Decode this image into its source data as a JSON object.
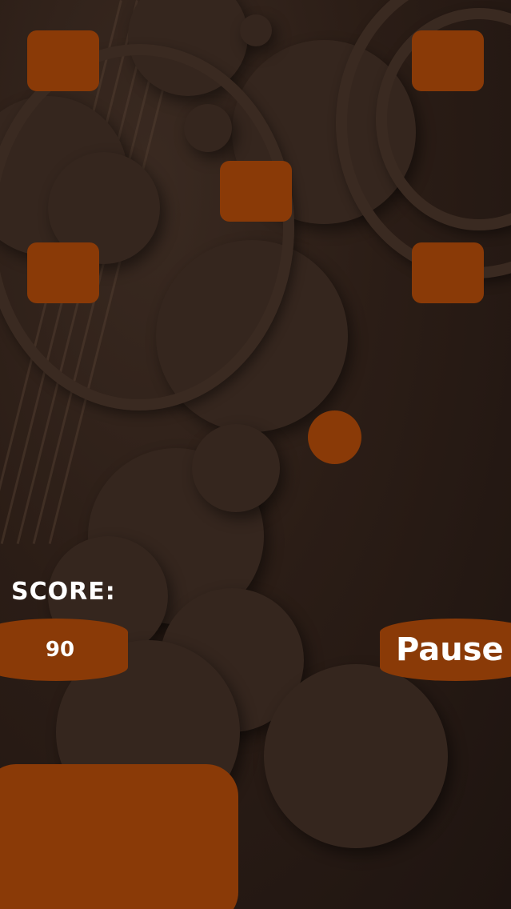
{
  "game": {
    "score_label": "SCORE:",
    "score_value": "90",
    "pause_label": "Pause"
  },
  "colors": {
    "accent": "#8a3a07",
    "background": "#2a1c15",
    "text": "#ffffff"
  }
}
